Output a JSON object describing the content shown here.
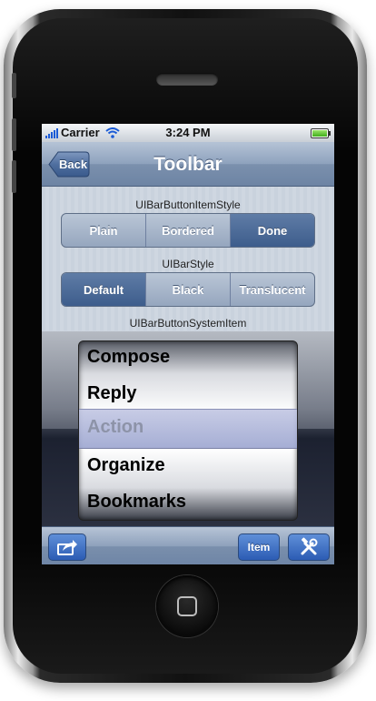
{
  "status_bar": {
    "carrier": "Carrier",
    "time": "3:24 PM"
  },
  "nav_bar": {
    "back_label": "Back",
    "title": "Toolbar"
  },
  "bar_button_item_style": {
    "label": "UIBarButtonItemStyle",
    "segments": [
      "Plain",
      "Bordered",
      "Done"
    ],
    "selected_index": 2
  },
  "bar_style": {
    "label": "UIBarStyle",
    "segments": [
      "Default",
      "Black",
      "Translucent"
    ],
    "selected_index": 0
  },
  "system_item": {
    "label": "UIBarButtonSystemItem",
    "picker_rows": [
      "Compose",
      "Reply",
      "Action",
      "Organize",
      "Bookmarks"
    ],
    "selected_row": "Action"
  },
  "toolbar": {
    "item_label": "Item"
  },
  "colors": {
    "nav_tint": "#7b90ad",
    "done_button": "#2c5cb4",
    "selected_segment": "#3d5d8c"
  },
  "icons": {
    "action": "action-icon",
    "tools": "tools-icon",
    "wifi": "wifi-icon",
    "battery": "battery-icon",
    "signal": "signal-icon"
  }
}
